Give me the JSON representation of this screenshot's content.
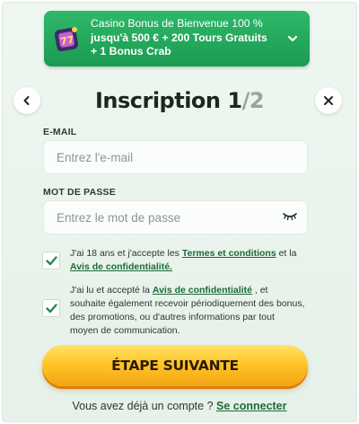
{
  "banner": {
    "line1": "Casino Bonus de Bienvenue 100 %",
    "line2": "jusqu'à 500 € + 200 Tours Gratuits",
    "line3": "+ 1 Bonus Crab",
    "icon": "casino-slot-icon",
    "colors": {
      "bg": "#22a85c",
      "text": "#ffffff"
    }
  },
  "header": {
    "title": "Inscription",
    "step_current": "1",
    "step_total": "/2",
    "back_icon": "chevron-left-icon",
    "close_icon": "close-icon"
  },
  "form": {
    "email": {
      "label": "E-MAIL",
      "placeholder": "Entrez l'e-mail",
      "value": ""
    },
    "password": {
      "label": "MOT DE PASSE",
      "placeholder": "Entrez le mot de passe",
      "value": "",
      "toggle_icon": "eye-closed-icon"
    },
    "consent1": {
      "checked": true,
      "text_before": "J'ai 18 ans et j'accepte les ",
      "link1": "Termes et conditions",
      "text_middle": " et la ",
      "link2": "Avis de confidentialité."
    },
    "consent2": {
      "checked": true,
      "text_before": "J'ai lu et accepté la ",
      "link": "Avis de confidentialité",
      "text_after": " , et souhaite également recevoir périodiquement des bonus, des promotions, ou d'autres informations par tout moyen de communication."
    },
    "submit_label": "ÉTAPE SUIVANTE"
  },
  "footer": {
    "text": "Vous avez déjà un compte ? ",
    "link": "Se connecter"
  },
  "colors": {
    "accent_green": "#1c6b39",
    "check_green": "#1f8a45",
    "cta_yellow": "#ffc526"
  }
}
